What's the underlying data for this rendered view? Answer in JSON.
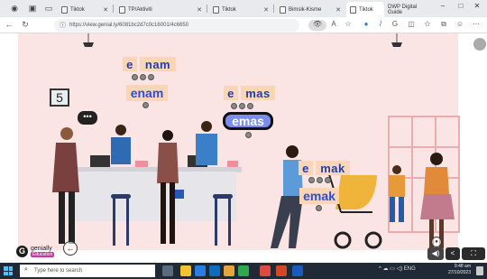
{
  "browser": {
    "tabs": [
      {
        "label": "Tiktok"
      },
      {
        "label": "TP/Aktiviti"
      },
      {
        "label": "Tiktok"
      },
      {
        "label": "Bimsik-Kisme"
      },
      {
        "label": "Tiktok"
      },
      {
        "label": "DWP Digital Guide"
      }
    ],
    "url": "https://view.genial.ly/6081bc2d7c0c16001/4c6650",
    "window_controls": [
      "–",
      "□",
      "✕"
    ]
  },
  "scene": {
    "sign_number": "5",
    "bubble": "•••",
    "group1": {
      "syl1": "e",
      "syl2": "nam",
      "word": "enam"
    },
    "group2": {
      "syl1": "e",
      "syl2": "mas",
      "word": "emas"
    },
    "group3": {
      "syl1": "e",
      "syl2": "mak",
      "word": "emak"
    }
  },
  "genially": {
    "logo": "G",
    "name": "genially",
    "badge": "Education"
  },
  "controls": {
    "prev": "←",
    "volume": "◀)",
    "share": "<",
    "fullscreen": "⛶"
  },
  "taskbar": {
    "search_placeholder": "Type here to search",
    "tray": "^ ☁ ▭ ◁) ENG",
    "time": "9:48 am",
    "date": "27/10/2023"
  },
  "colors": {
    "wall": "#fbe4e4",
    "syllable_box": "#fbd5b8",
    "word_text": "#2b4fd6",
    "highlight": "#7a8cf0"
  }
}
